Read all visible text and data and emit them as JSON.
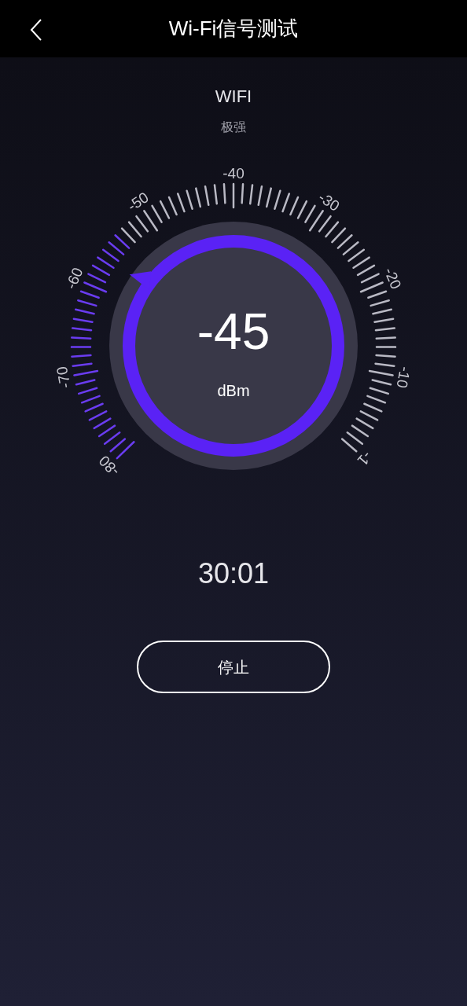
{
  "header": {
    "title": "Wi-Fi信号测试"
  },
  "network": {
    "name": "WIFI",
    "strength": "极强"
  },
  "gauge": {
    "scale_labels": [
      "-80",
      "-70",
      "-60",
      "-50",
      "-40",
      "-30",
      "-20",
      "-10",
      "-1"
    ],
    "reading": "-45",
    "unit": "dBm"
  },
  "timer": "30:01",
  "stop_button": "停止"
}
